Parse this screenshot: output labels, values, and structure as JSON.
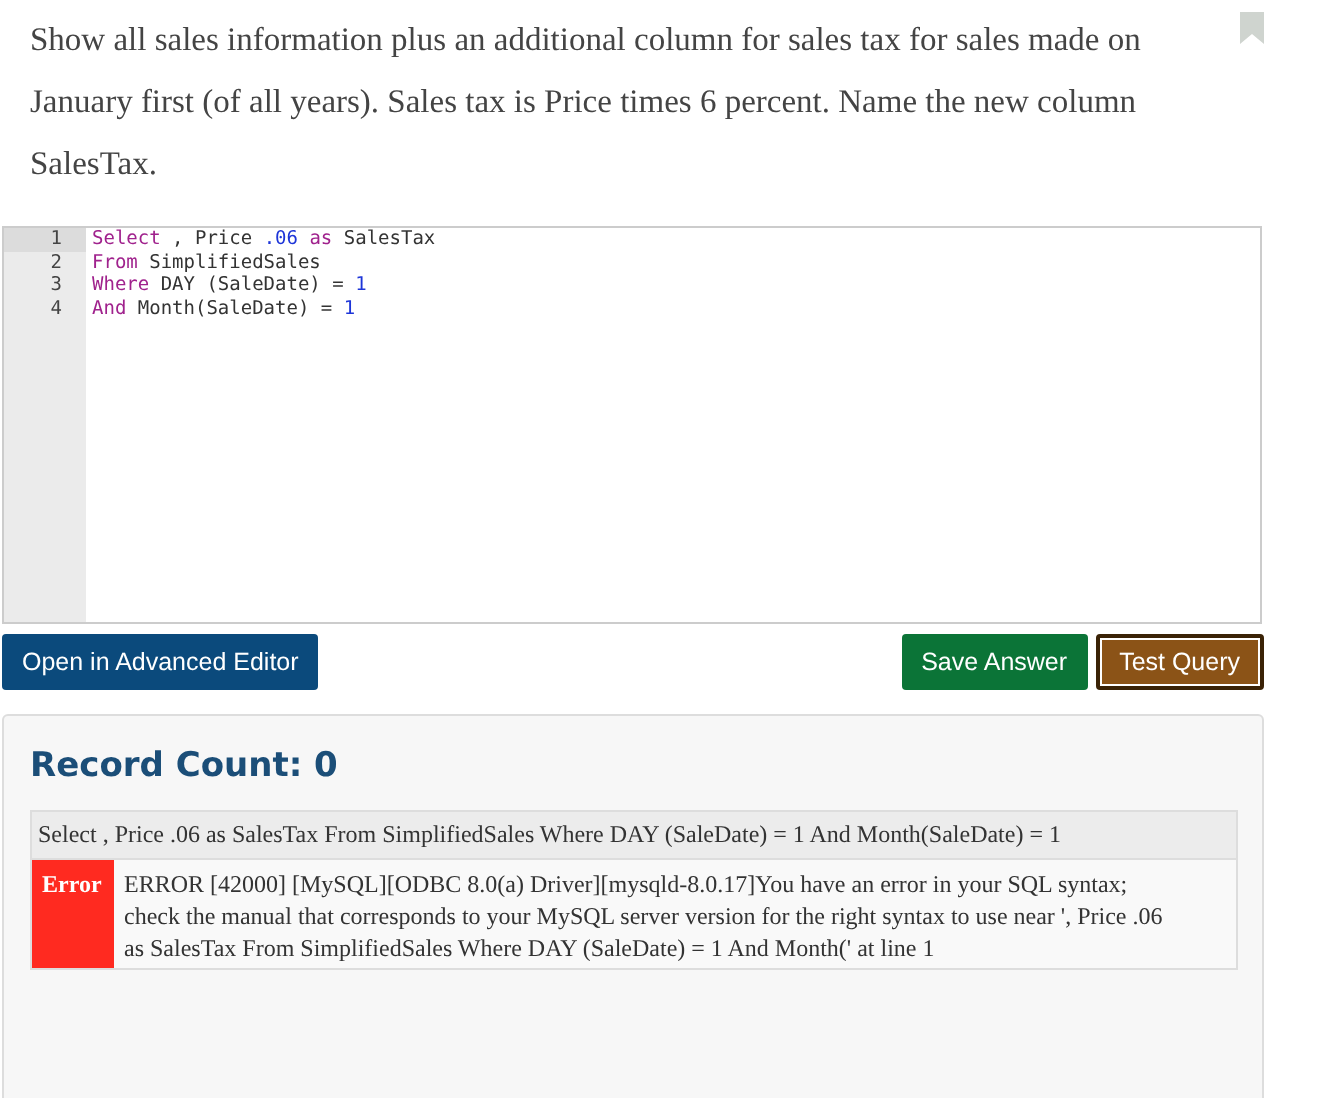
{
  "question": "Show all sales information plus an additional column for sales tax for sales made on January first (of all years). Sales tax is Price times 6 percent. Name the new column SalesTax.",
  "bookmarked": false,
  "editor": {
    "lines": [
      {
        "number": "1",
        "tokens": [
          {
            "kind": "keyword",
            "text": "Select"
          },
          {
            "kind": "plain",
            "text": " , Price "
          },
          {
            "kind": "number",
            "text": ".06"
          },
          {
            "kind": "keyword",
            "text": " as"
          },
          {
            "kind": "plain",
            "text": " SalesTax"
          }
        ]
      },
      {
        "number": "2",
        "tokens": [
          {
            "kind": "keyword",
            "text": "From"
          },
          {
            "kind": "plain",
            "text": " SimplifiedSales"
          }
        ]
      },
      {
        "number": "3",
        "tokens": [
          {
            "kind": "keyword",
            "text": "Where"
          },
          {
            "kind": "plain",
            "text": " DAY (SaleDate) = "
          },
          {
            "kind": "number",
            "text": "1"
          }
        ]
      },
      {
        "number": "4",
        "tokens": [
          {
            "kind": "keyword",
            "text": "And"
          },
          {
            "kind": "plain",
            "text": " Month(SaleDate) = "
          },
          {
            "kind": "number",
            "text": "1"
          }
        ]
      }
    ]
  },
  "buttons": {
    "advanced": "Open in Advanced Editor",
    "save": "Save Answer",
    "test": "Test Query"
  },
  "result": {
    "title": "Record Count: 0",
    "query": "Select , Price .06 as SalesTax From SimplifiedSales Where DAY (SaleDate) = 1 And Month(SaleDate) = 1",
    "error_label": "Error",
    "error_message": "ERROR [42000] [MySQL][ODBC 8.0(a) Driver][mysqld-8.0.17]You have an error in your SQL syntax; check the manual that corresponds to your MySQL server version for the right syntax to use near ', Price .06 as SalesTax From SimplifiedSales Where DAY (SaleDate) = 1 And Month(' at line 1"
  }
}
